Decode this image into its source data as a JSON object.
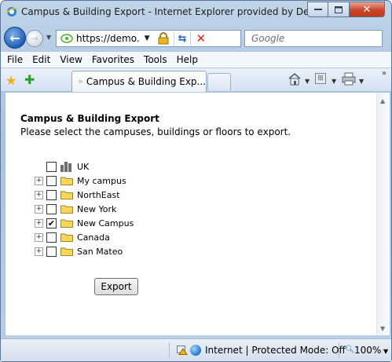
{
  "window": {
    "title": "Campus & Building Export - Internet Explorer provided by Dell",
    "close_glyph": "✕"
  },
  "address": {
    "url": "https://demo.",
    "search_placeholder": "Google"
  },
  "menu": [
    "File",
    "Edit",
    "View",
    "Favorites",
    "Tools",
    "Help"
  ],
  "tab": {
    "label": "Campus & Building Exp..."
  },
  "page": {
    "heading": "Campus & Building Export",
    "subtitle": "Please select the campuses, buildings or floors to export.",
    "tree": [
      {
        "label": "UK",
        "expandable": false,
        "checked": false,
        "icon": "building-icon"
      },
      {
        "label": "My campus",
        "expandable": true,
        "checked": false,
        "icon": "folder-icon"
      },
      {
        "label": "NorthEast",
        "expandable": true,
        "checked": false,
        "icon": "folder-icon"
      },
      {
        "label": "New York",
        "expandable": true,
        "checked": false,
        "icon": "folder-icon"
      },
      {
        "label": "New Campus",
        "expandable": true,
        "checked": true,
        "icon": "folder-icon"
      },
      {
        "label": "Canada",
        "expandable": true,
        "checked": false,
        "icon": "folder-icon"
      },
      {
        "label": "San Mateo",
        "expandable": true,
        "checked": false,
        "icon": "folder-icon"
      }
    ],
    "export_label": "Export"
  },
  "status": {
    "zone": "Internet | Protected Mode: Off",
    "zoom": "100%"
  },
  "colors": {
    "accent_blue": "#1f5fb5",
    "close_red": "#c8442a",
    "folder_yellow": "#f7d75a"
  }
}
